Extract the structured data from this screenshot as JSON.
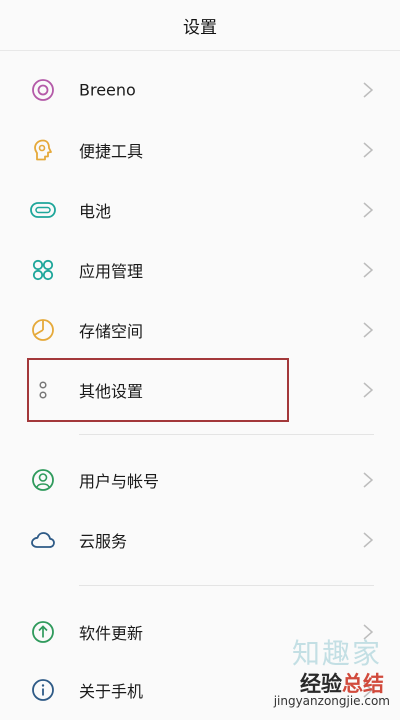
{
  "header": {
    "title": "设置"
  },
  "colors": {
    "highlight_border": "#a3383a",
    "watermark_accent": "#d14a3c"
  },
  "items": [
    {
      "label": "Breeno",
      "icon": "breeno-icon",
      "color": "#b45aa8"
    },
    {
      "label": "便捷工具",
      "icon": "convenience-tools-icon",
      "color": "#e5a93a"
    },
    {
      "label": "电池",
      "icon": "battery-icon",
      "color": "#1ea69a"
    },
    {
      "label": "应用管理",
      "icon": "app-management-icon",
      "color": "#1ea69a"
    },
    {
      "label": "存储空间",
      "icon": "storage-icon",
      "color": "#e5a93a"
    },
    {
      "label": "其他设置",
      "icon": "other-settings-icon",
      "color": "#777777"
    },
    {
      "label": "用户与帐号",
      "icon": "user-account-icon",
      "color": "#2f9a5c"
    },
    {
      "label": "云服务",
      "icon": "cloud-service-icon",
      "color": "#2e5a86"
    },
    {
      "label": "软件更新",
      "icon": "software-update-icon",
      "color": "#2f9a5c"
    },
    {
      "label": "关于手机",
      "icon": "about-phone-icon",
      "color": "#2e5a86"
    }
  ],
  "watermark": {
    "big": "知趣家",
    "cn_part1": "经验",
    "cn_part2": "总结",
    "url": "jingyanzongjie.com"
  }
}
